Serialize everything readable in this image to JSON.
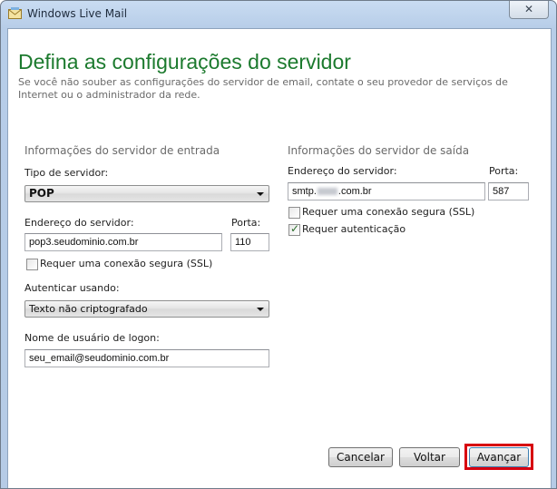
{
  "window": {
    "title": "Windows Live Mail",
    "close_glyph": "✕"
  },
  "page": {
    "heading": "Defina as configurações do servidor",
    "subtitle": "Se você não souber as configurações do servidor de email, contate o seu provedor de serviços de Internet ou o administrador da rede."
  },
  "incoming": {
    "group_title": "Informações do servidor de entrada",
    "server_type_label": "Tipo de servidor:",
    "server_type_value": "POP",
    "address_label": "Endereço do servidor:",
    "address_value": "pop3.seudominio.com.br",
    "port_label": "Porta:",
    "port_value": "110",
    "ssl_label": "Requer uma conexão segura (SSL)",
    "ssl_checked": false,
    "auth_label": "Autenticar usando:",
    "auth_value": "Texto não criptografado",
    "logon_label": "Nome de usuário de logon:",
    "logon_value": "seu_email@seudominio.com.br"
  },
  "outgoing": {
    "group_title": "Informações do servidor de saída",
    "address_label": "Endereço do servidor:",
    "address_prefix": "smtp.",
    "address_suffix": ".com.br",
    "port_label": "Porta:",
    "port_value": "587",
    "ssl_label": "Requer uma conexão segura (SSL)",
    "ssl_checked": false,
    "auth_required_label": "Requer autenticação",
    "auth_required_checked": true
  },
  "buttons": {
    "cancel": "Cancelar",
    "back": "Voltar",
    "next": "Avançar"
  },
  "colors": {
    "heading_green": "#1c7a2e",
    "highlight_red": "#d7000f"
  },
  "icons": {
    "app": "windows-live-mail-icon",
    "close": "close-icon",
    "dropdown": "chevron-down-icon",
    "check": "checkmark-icon"
  }
}
